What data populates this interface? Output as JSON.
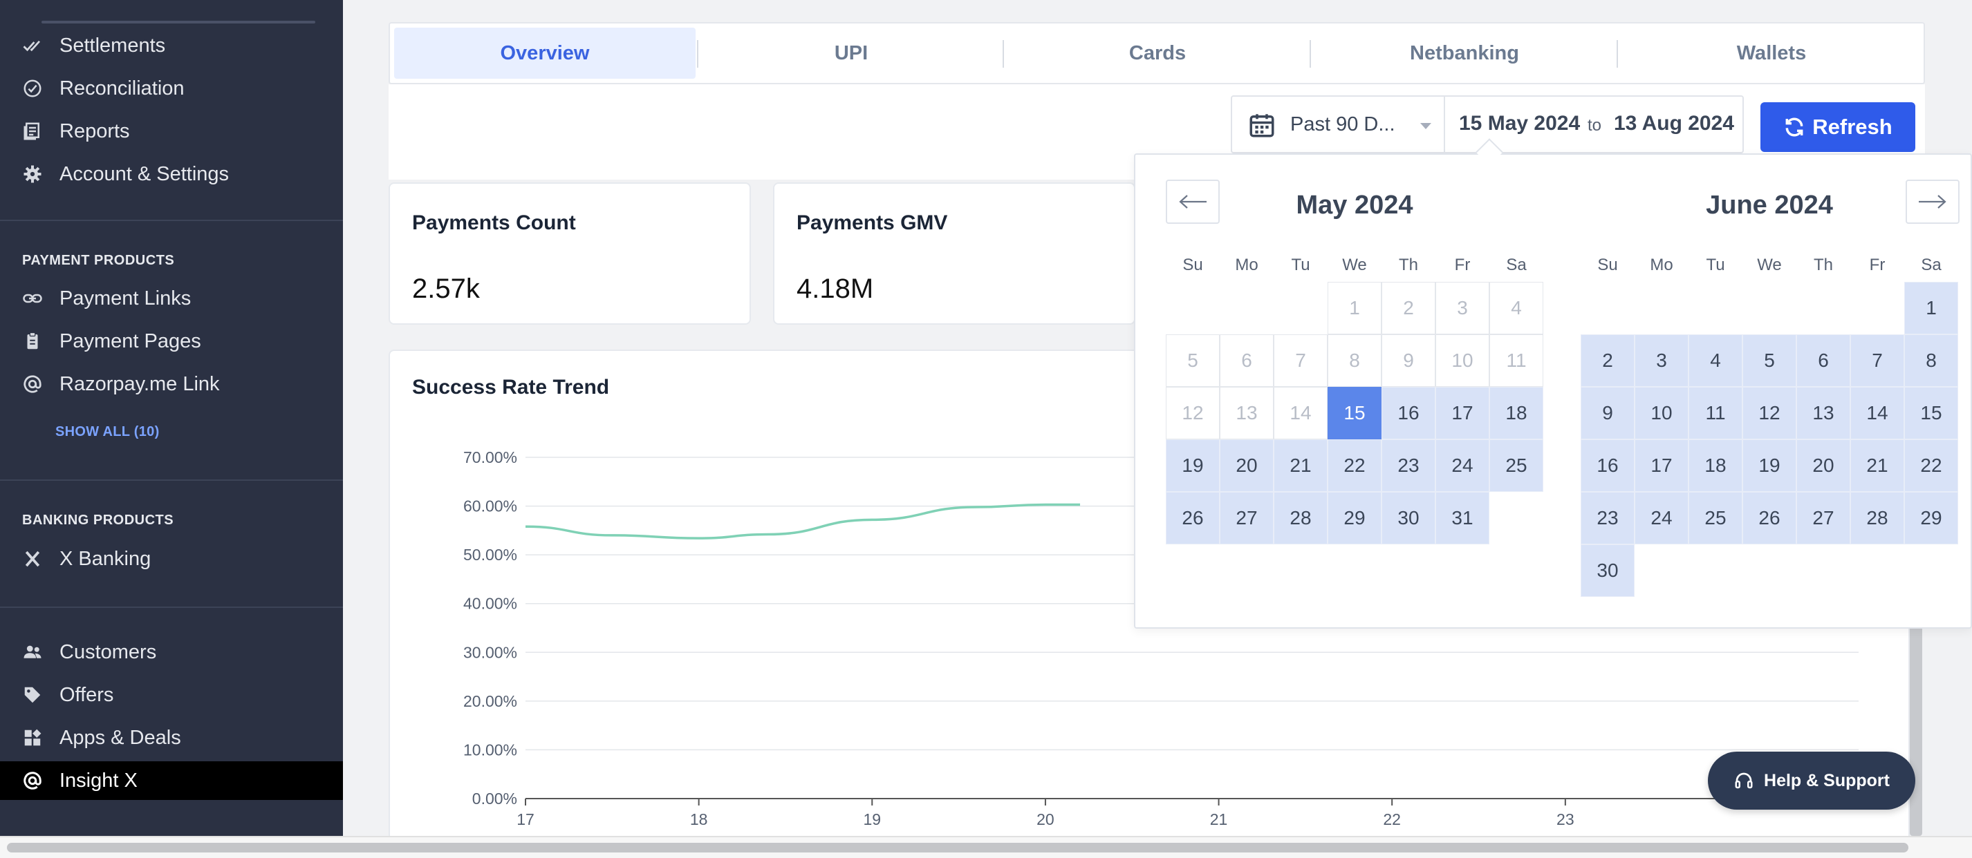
{
  "sidebar": {
    "items_top": [
      {
        "label": "Settlements",
        "icon": "double-check-icon"
      },
      {
        "label": "Reconciliation",
        "icon": "check-circle-icon"
      },
      {
        "label": "Reports",
        "icon": "reports-icon"
      },
      {
        "label": "Account & Settings",
        "icon": "gear-icon"
      }
    ],
    "payment_products": {
      "heading": "PAYMENT PRODUCTS",
      "items": [
        {
          "label": "Payment Links",
          "icon": "link-icon"
        },
        {
          "label": "Payment Pages",
          "icon": "page-icon"
        },
        {
          "label": "Razorpay.me Link",
          "icon": "at-icon"
        }
      ],
      "show_all": "SHOW ALL (10)"
    },
    "banking_products": {
      "heading": "BANKING PRODUCTS",
      "items": [
        {
          "label": "X Banking",
          "icon": "x-logo-icon"
        }
      ]
    },
    "items_bottom": [
      {
        "label": "Customers",
        "icon": "people-icon"
      },
      {
        "label": "Offers",
        "icon": "tag-icon"
      },
      {
        "label": "Apps & Deals",
        "icon": "apps-icon"
      },
      {
        "label": "Insight X",
        "icon": "at-icon",
        "active": true
      }
    ]
  },
  "tabs": [
    {
      "label": "Overview",
      "active": true
    },
    {
      "label": "UPI"
    },
    {
      "label": "Cards"
    },
    {
      "label": "Netbanking"
    },
    {
      "label": "Wallets"
    }
  ],
  "filters": {
    "range_label": "Past 90 D...",
    "start_date": "15 May 2024",
    "to_label": "to",
    "end_date": "13 Aug 2024",
    "refresh_label": "Refresh"
  },
  "stats": [
    {
      "title": "Payments Count",
      "value": "2.57k"
    },
    {
      "title": "Payments GMV",
      "value": "4.18M"
    }
  ],
  "chart_data": {
    "type": "line",
    "title": "Success Rate Trend",
    "x": [
      17,
      18,
      19,
      20,
      21,
      22,
      23
    ],
    "x_ticks": [
      "17",
      "18",
      "19",
      "20",
      "21",
      "22",
      "23"
    ],
    "y_ticks": [
      "0.00%",
      "10.00%",
      "20.00%",
      "30.00%",
      "40.00%",
      "50.00%",
      "60.00%",
      "70.00%"
    ],
    "ylim": [
      0,
      70
    ],
    "series": [
      {
        "x": [
          17,
          17.5,
          18,
          18.4,
          19,
          19.6,
          20,
          20.2
        ],
        "values": [
          55.8,
          54.0,
          53.4,
          54.2,
          57.2,
          59.8,
          60.3,
          60.3
        ],
        "color": "#7fd1b5"
      }
    ],
    "grid": true
  },
  "datepicker": {
    "months": [
      {
        "title": "May 2024",
        "start_weekday": 3,
        "days": 31
      },
      {
        "title": "June 2024",
        "start_weekday": 6,
        "days": 30
      }
    ],
    "weekdays": [
      "Su",
      "Mo",
      "Tu",
      "We",
      "Th",
      "Fr",
      "Sa"
    ],
    "selected": {
      "month": 0,
      "day": 15
    }
  },
  "help_label": "Help & Support",
  "colors": {
    "accent": "#2f5bea",
    "sidebar": "#2b3143",
    "range": "#d8e2f7",
    "selected": "#5b86ea"
  }
}
